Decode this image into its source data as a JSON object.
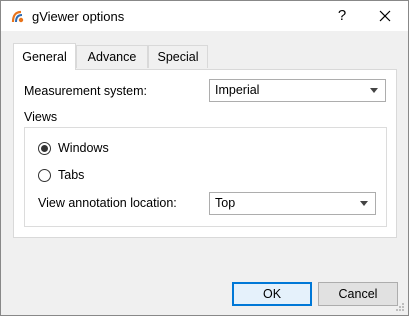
{
  "window": {
    "title": "gViewer options",
    "help_label": "?",
    "icons": {
      "app": "gviewer-app-icon",
      "close": "close-icon"
    }
  },
  "tabs": [
    {
      "label": "General",
      "active": true
    },
    {
      "label": "Advance",
      "active": false
    },
    {
      "label": "Special",
      "active": false
    }
  ],
  "general": {
    "measurement_label": "Measurement system:",
    "measurement_value": "Imperial",
    "views_label": "Views",
    "radio_windows": {
      "label": "Windows",
      "checked": true
    },
    "radio_tabs": {
      "label": "Tabs",
      "checked": false
    },
    "annotation_label": "View annotation location:",
    "annotation_value": "Top"
  },
  "buttons": {
    "ok": "OK",
    "cancel": "Cancel"
  }
}
